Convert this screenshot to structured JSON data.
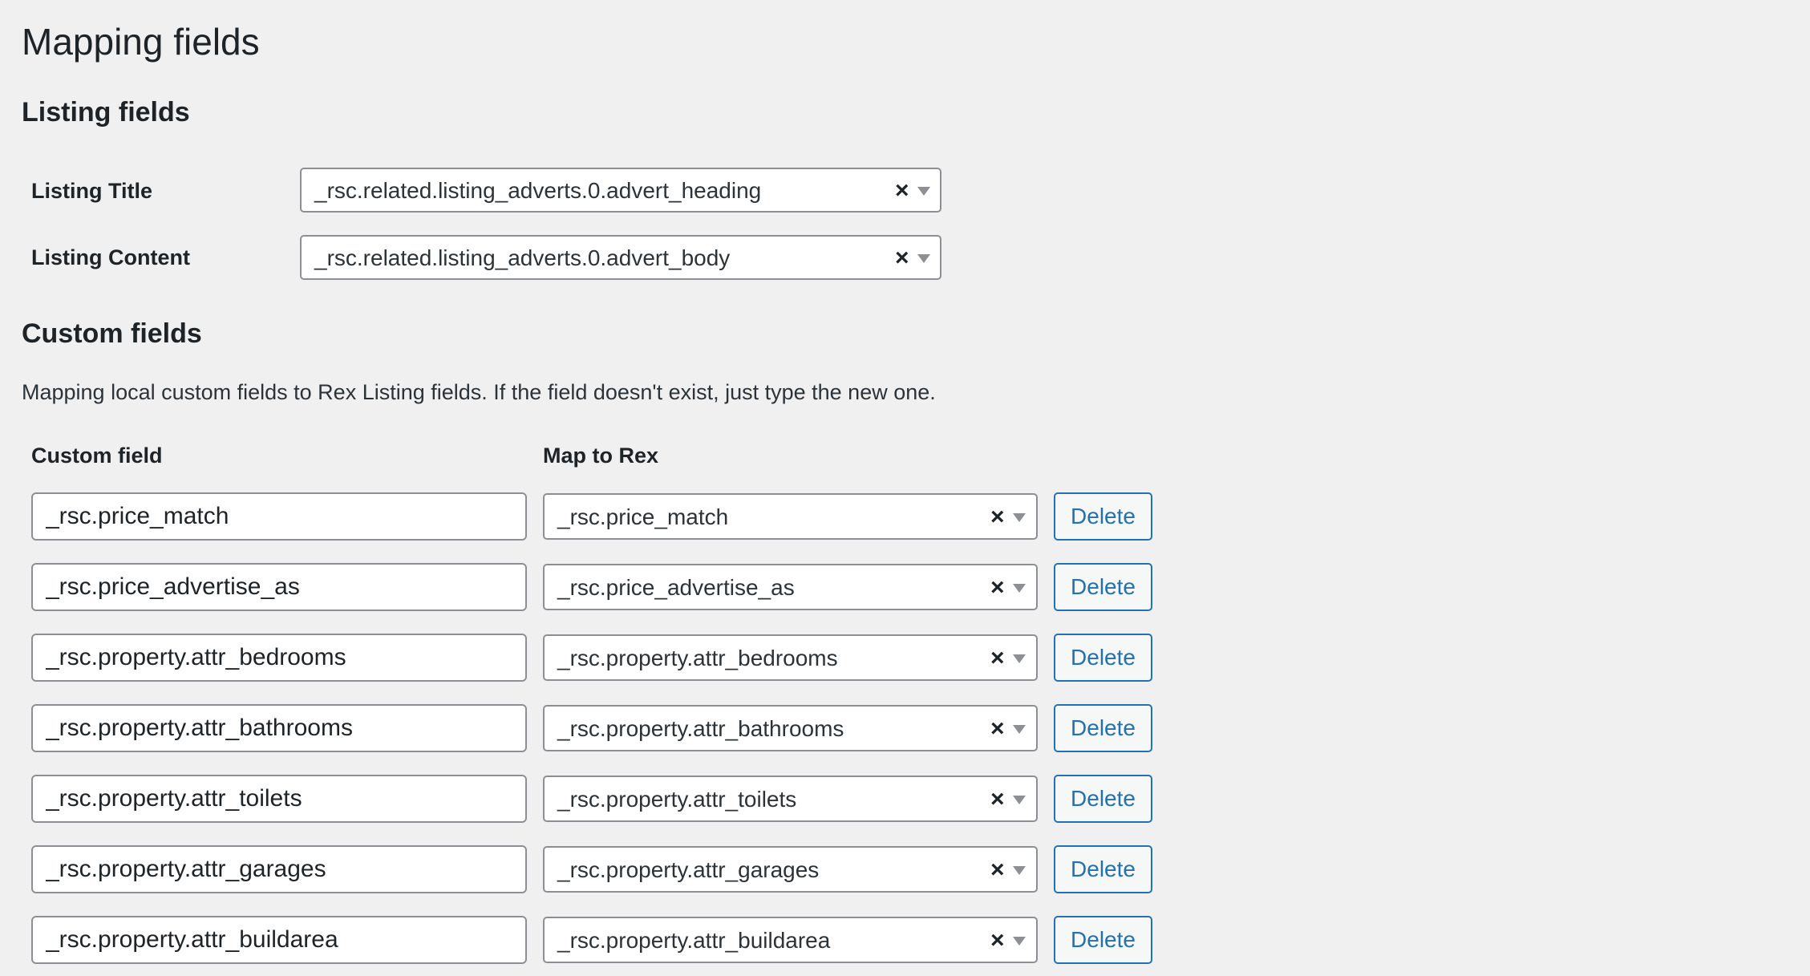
{
  "page_title": "Mapping fields",
  "listing_section": {
    "title": "Listing fields",
    "fields": [
      {
        "label": "Listing Title",
        "value": "_rsc.related.listing_adverts.0.advert_heading"
      },
      {
        "label": "Listing Content",
        "value": "_rsc.related.listing_adverts.0.advert_body"
      }
    ]
  },
  "custom_section": {
    "title": "Custom fields",
    "description": "Mapping local custom fields to Rex Listing fields. If the field doesn't exist, just type the new one.",
    "col_custom": "Custom field",
    "col_map": "Map to Rex",
    "clear_glyph": "×",
    "delete_label": "Delete",
    "rows": [
      {
        "custom": "_rsc.price_match",
        "map": "_rsc.price_match"
      },
      {
        "custom": "_rsc.price_advertise_as",
        "map": "_rsc.price_advertise_as"
      },
      {
        "custom": "_rsc.property.attr_bedrooms",
        "map": "_rsc.property.attr_bedrooms"
      },
      {
        "custom": "_rsc.property.attr_bathrooms",
        "map": "_rsc.property.attr_bathrooms"
      },
      {
        "custom": "_rsc.property.attr_toilets",
        "map": "_rsc.property.attr_toilets"
      },
      {
        "custom": "_rsc.property.attr_garages",
        "map": "_rsc.property.attr_garages"
      },
      {
        "custom": "_rsc.property.attr_buildarea",
        "map": "_rsc.property.attr_buildarea"
      }
    ]
  },
  "colors": {
    "background": "#f0f0f1",
    "accent": "#2271b1",
    "border": "#8c8f94"
  }
}
